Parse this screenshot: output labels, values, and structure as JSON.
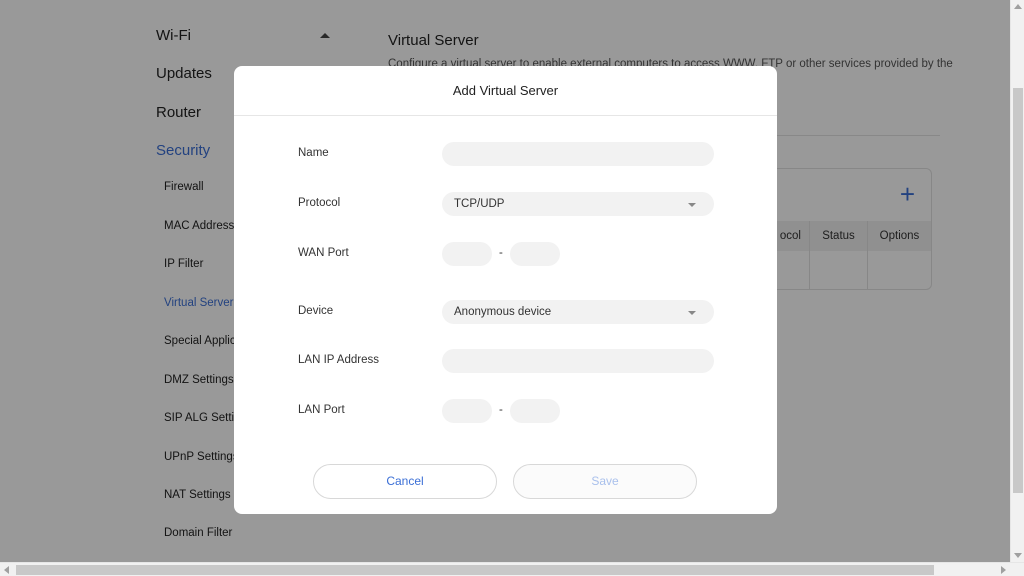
{
  "sidebar": {
    "top_items": [
      {
        "label": "Wi-Fi"
      },
      {
        "label": "Updates"
      },
      {
        "label": "Router"
      },
      {
        "label": "Security"
      }
    ],
    "sub_items": [
      {
        "label": "Firewall"
      },
      {
        "label": "MAC Address"
      },
      {
        "label": "IP Filter"
      },
      {
        "label": "Virtual Server"
      },
      {
        "label": "Special Applic"
      },
      {
        "label": "DMZ Settings"
      },
      {
        "label": "SIP ALG Setti"
      },
      {
        "label": "UPnP Settings"
      },
      {
        "label": "NAT Settings"
      },
      {
        "label": "Domain Filter"
      }
    ]
  },
  "main": {
    "title": "Virtual Server",
    "description": "Configure a virtual server to enable external computers to access WWW, FTP or other services provided by the",
    "table": {
      "columns": [
        "ocol",
        "Status",
        "Options"
      ]
    }
  },
  "modal": {
    "title": "Add Virtual Server",
    "fields": {
      "name": {
        "label": "Name",
        "value": ""
      },
      "protocol": {
        "label": "Protocol",
        "value": "TCP/UDP"
      },
      "wan_port": {
        "label": "WAN Port",
        "start": "",
        "end": "",
        "separator": "-"
      },
      "device": {
        "label": "Device",
        "value": "Anonymous device"
      },
      "lan_ip": {
        "label": "LAN IP Address",
        "value": ""
      },
      "lan_port": {
        "label": "LAN Port",
        "start": "",
        "end": "",
        "separator": "-"
      }
    },
    "buttons": {
      "cancel": "Cancel",
      "save": "Save"
    }
  },
  "colors": {
    "accent": "#3b6fd6",
    "overlay": "rgba(0,0,0,0.4)",
    "input_bg": "#f2f2f2"
  }
}
